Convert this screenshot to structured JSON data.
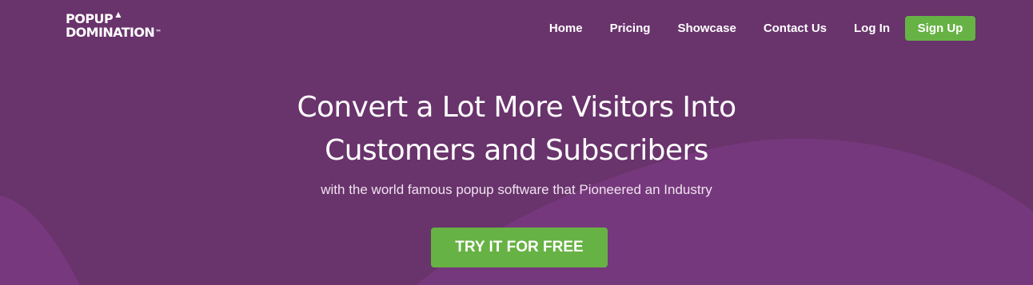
{
  "header": {
    "logo": {
      "line1": "POPUP",
      "line2": "DOMINATION",
      "trademark": "™"
    },
    "nav": [
      {
        "label": "Home"
      },
      {
        "label": "Pricing"
      },
      {
        "label": "Showcase"
      },
      {
        "label": "Contact Us"
      },
      {
        "label": "Log In"
      }
    ],
    "signup_label": "Sign Up"
  },
  "hero": {
    "headline_line1": "Convert a Lot More Visitors Into",
    "headline_line2": "Customers and Subscribers",
    "subheadline": "with the world famous popup software that Pioneered an Industry",
    "cta_label": "TRY IT FOR FREE"
  },
  "colors": {
    "background": "#69336c",
    "wave": "#7a3a80",
    "accent_green": "#67b244"
  }
}
